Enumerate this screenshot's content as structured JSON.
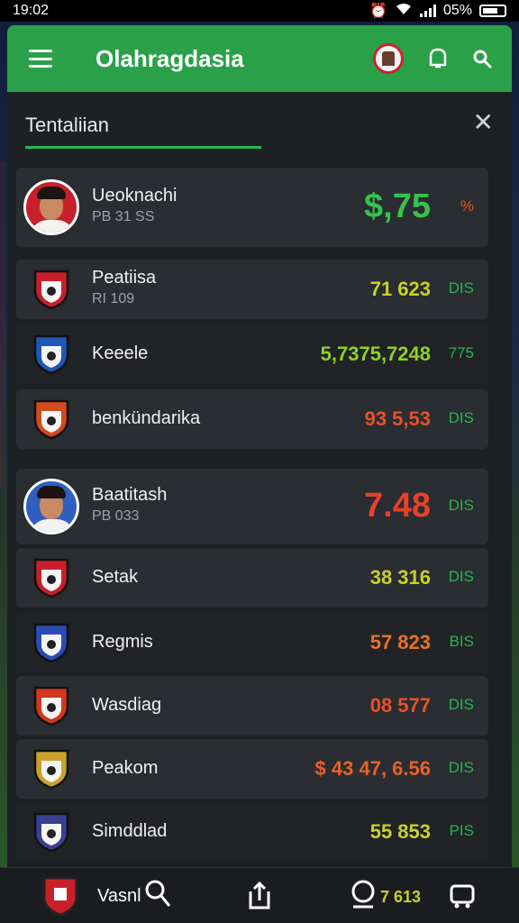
{
  "status": {
    "time": "19:02",
    "battery": "05%"
  },
  "appbar": {
    "title": "Olahragdasia"
  },
  "sheet": {
    "title": "Tentaliian"
  },
  "rows": [
    {
      "name": "Ueoknachi",
      "sub": "PB 31 SS",
      "value": "$,75",
      "unit": "%",
      "value_color": "#36c24e",
      "unit_color": "#e8512a",
      "kind": "player"
    },
    {
      "name": "Peatiisa",
      "sub": "RI 109",
      "value": "71 623",
      "unit": "DIS",
      "value_color": "#c7d12a",
      "unit_color": "#2ab352",
      "kind": "club"
    },
    {
      "name": "Keeele",
      "value": "5,7375,7248",
      "unit": "775",
      "value_color": "#8ed12a",
      "unit_color": "#2ab352",
      "kind": "club"
    },
    {
      "name": "benkündarika",
      "value": "93 5,53",
      "unit": "DIS",
      "value_color": "#e8512a",
      "unit_color": "#2ab352",
      "kind": "club"
    },
    {
      "name": "Baatitash",
      "sub": "PB 033",
      "value": "7.48",
      "unit": "DIS",
      "value_color": "#e8412a",
      "unit_color": "#2ab352",
      "kind": "player"
    },
    {
      "name": "Setak",
      "value": "38 316",
      "unit": "DIS",
      "value_color": "#c7d12a",
      "unit_color": "#2ab352",
      "kind": "club"
    },
    {
      "name": "Regmis",
      "value": "57 823",
      "unit": "BIS",
      "value_color": "#e8712a",
      "unit_color": "#2ab352",
      "kind": "club"
    },
    {
      "name": "Wasdiag",
      "value": "08 577",
      "unit": "DIS",
      "value_color": "#e8512a",
      "unit_color": "#2ab352",
      "kind": "club"
    },
    {
      "name": "Peakom",
      "value": "$ 43 47, 6.56",
      "unit": "DIS",
      "value_color": "#e8612a",
      "unit_color": "#2ab352",
      "kind": "club"
    },
    {
      "name": "Simddlad",
      "value": "55 853",
      "unit": "PIS",
      "value_color": "#c7d12a",
      "unit_color": "#2ab352",
      "kind": "club"
    }
  ],
  "bottom_nav": {
    "label": "Vasnl",
    "score": "7 613"
  },
  "colors": {
    "accent": "#2aa148",
    "panel": "#1e2124"
  }
}
